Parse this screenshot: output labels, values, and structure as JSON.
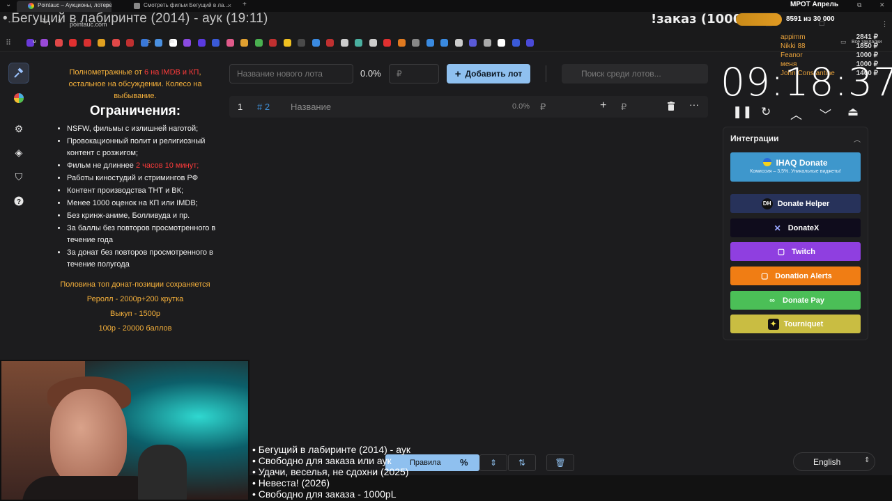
{
  "browser": {
    "tabs": [
      {
        "title": "Pointauc – Аукционы, лотереи"
      },
      {
        "title": "Смотреть фильм Бегущий в ла..."
      }
    ],
    "address": "pointauc.com",
    "bookmarks_end_label": "Все закладки",
    "bookmark_labels": [
      "м",
      "b",
      "m"
    ]
  },
  "overlay": {
    "title": "• Бегущий в лабиринте (2014) - аук (19:11)",
    "order_text": "!заказ (1000р)",
    "mrot_label": "МРОТ Апрель",
    "mrot_count": "8591  из 30 000",
    "donors": [
      {
        "name": "appimm",
        "amount": "2841 ₽"
      },
      {
        "name": "Nikki 88",
        "amount": "1850 ₽"
      },
      {
        "name": "Feanor",
        "amount": "1000 ₽"
      },
      {
        "name": "меня",
        "amount": "1000 ₽"
      },
      {
        "name": "John Constantine",
        "amount": "1400 ₽"
      }
    ]
  },
  "rules": {
    "intro_before": "Полнометражные от ",
    "intro_highlight": "6 на IMDB и КП",
    "intro_after": ", остальное на обсуждении. Колесо на выбывание.",
    "heading": "Ограничения:",
    "items": [
      "NSFW, фильмы с излишней наготой;",
      "Провокационный полит и религиозный контент с розжигом;",
      "Фильм не длиннее ",
      "Работы киностудий и стримингов РФ",
      "Контент производства ТНТ и ВК;",
      "Менее 1000 оценок на КП или IMDB;",
      "Без кринж-аниме, Болливуда и пр.",
      "За баллы без повторов просмотренного в течение года",
      "За донат без повторов просмотренного в течение полугода"
    ],
    "duration_highlight": "2 часов 10 минут;",
    "footer": [
      "Половина топ донат-позиции сохраняется",
      "Реролл - 2000р+200 крутка",
      "Выкуп - 1500р",
      "100р - 20000 баллов"
    ]
  },
  "controls": {
    "lot_placeholder": "Название нового лота",
    "percent": "0.0%",
    "rub_placeholder": "₽",
    "add_button": "Добавить лот",
    "search_placeholder": "Поиск среди лотов..."
  },
  "lot": {
    "index": "1",
    "id": "# 2",
    "name": "Название",
    "percent": "0.0%",
    "currency": "₽"
  },
  "timer": {
    "value": "09:18:37"
  },
  "integrations": {
    "title": "Интеграции",
    "ihaq_title": "IHAQ Donate",
    "ihaq_sub": "Комиссия – 3,5%. Уникальные виджеты!",
    "buttons": [
      {
        "label": "Donate Helper",
        "color": "#27325a"
      },
      {
        "label": "DonateX",
        "color": "#0f0c1c"
      },
      {
        "label": "Twitch",
        "color": "#8f3fe0"
      },
      {
        "label": "Donation Alerts",
        "color": "#f07d14"
      },
      {
        "label": "Donate Pay",
        "color": "#4bbf57"
      },
      {
        "label": "Tourniquet",
        "color": "#c9bd42"
      }
    ]
  },
  "queue": [
    "• Бегущий в лабиринте (2014) - аук",
    "• Свободно для заказа или аук",
    "• Удачи, веселья, не сдохни (2025)",
    "• Невеста! (2026)",
    "• Свободно для заказа - 1000рL"
  ],
  "bottom_toolbar": {
    "rules_label": "Правила",
    "percent_label": "%"
  },
  "language": "English"
}
